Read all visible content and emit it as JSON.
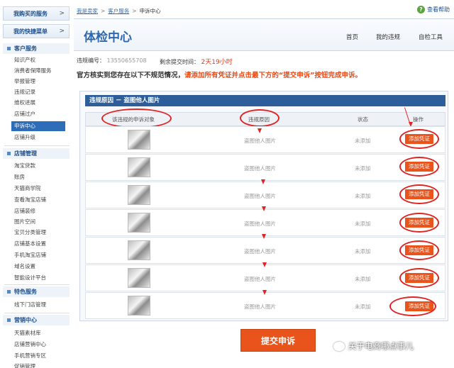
{
  "sidebar": {
    "purchased": "我购买的服务",
    "shortcut": "我的快捷菜单",
    "arrow": ">",
    "groups": [
      {
        "title": "客户服务",
        "items": [
          "知识产权",
          "消费者保障服务",
          "举报管理",
          "违规记录",
          "维权进展",
          "店铺过户",
          "申诉中心",
          "店铺升级"
        ]
      },
      {
        "title": "店铺管理",
        "items": [
          "淘宝贷款",
          "账房",
          "天猫商学院",
          "查看淘宝店铺",
          "店铺装修",
          "图片空间",
          "宝贝分类管理",
          "店铺基本设置",
          "手机淘宝店铺",
          "域名设置",
          "智能设计平台"
        ]
      },
      {
        "title": "特色服务",
        "items": [
          "线下门店管理"
        ]
      },
      {
        "title": "营销中心",
        "items": [
          "天猫素材库",
          "店铺营销中心",
          "手机营销专区",
          "促销管理"
        ]
      }
    ]
  },
  "breadcrumb": [
    "我是卖家",
    "客户服务",
    "申诉中心"
  ],
  "breadcrumb_sep": ">",
  "help": {
    "icon": "question-icon",
    "glyph": "?",
    "label": "查看帮助"
  },
  "header": {
    "title": "体检中心",
    "nav": [
      "首页",
      "我的违规",
      "自检工具"
    ]
  },
  "info": {
    "id_label": "违规编号：",
    "id_value": "13550655708",
    "deadline_label": "剩余提交时间：",
    "deadline_value": "2天19小时"
  },
  "notice": {
    "prefix": "官方核实到您存在以下不规范情况，",
    "highlight": "请添加所有凭证并点击最下方的“提交申诉”按钮完成申诉。"
  },
  "panel": {
    "title": "违规原因 － 盗图他人图片",
    "columns": [
      "该违规的申诉对象",
      "违规原因",
      "状态",
      "操作"
    ],
    "rows": [
      {
        "reason": "盗图他人图片",
        "status": "未添加",
        "action": "添加凭证"
      },
      {
        "reason": "盗图他人图片",
        "status": "未添加",
        "action": "添加凭证"
      },
      {
        "reason": "盗图他人图片",
        "status": "未添加",
        "action": "添加凭证"
      },
      {
        "reason": "盗图他人图片",
        "status": "未添加",
        "action": "添加凭证"
      },
      {
        "reason": "盗图他人图片",
        "status": "未添加",
        "action": "添加凭证"
      },
      {
        "reason": "盗图他人图片",
        "status": "未添加",
        "action": "添加凭证"
      },
      {
        "reason": "盗图他人图片",
        "status": "未添加",
        "action": "添加凭证"
      }
    ]
  },
  "submit_label": "提交申诉",
  "watermark": "关于电商哪点事儿",
  "colors": {
    "accent": "#2d67ad",
    "action": "#e8541c",
    "annotation": "#e02424"
  }
}
